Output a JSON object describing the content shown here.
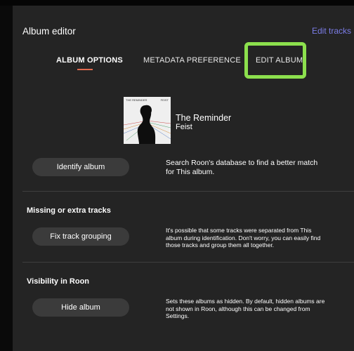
{
  "header": {
    "title": "Album editor",
    "edit_tracks_link": "Edit tracks"
  },
  "tabs": [
    {
      "label": "ALBUM OPTIONS",
      "active": true
    },
    {
      "label": "METADATA PREFERENCE",
      "active": false
    },
    {
      "label": "EDIT ALBUM",
      "active": false,
      "highlighted": true
    }
  ],
  "album": {
    "title": "The Reminder",
    "artist": "Feist",
    "cover_text_left": "THE REMINDER",
    "cover_text_right": "FEIST"
  },
  "identify": {
    "button_label": "Identify album",
    "description": "Search Roon's database to find a better match for This album."
  },
  "missing_tracks": {
    "section_title": "Missing or extra tracks",
    "button_label": "Fix track grouping",
    "description": "It's possible that some tracks were separated from This album during identification. Don't worry, you can easily find those tracks and group them all together."
  },
  "visibility": {
    "section_title": "Visibility in Roon",
    "button_label": "Hide album",
    "description": "Sets these albums as hidden. By default, hidden albums are not shown in Roon, although this can be changed from Settings."
  },
  "colors": {
    "accent_link": "#7b7ce6",
    "tab_underline": "#e26a4f",
    "highlight_box": "#8ce04d",
    "panel_bg": "#242424"
  }
}
